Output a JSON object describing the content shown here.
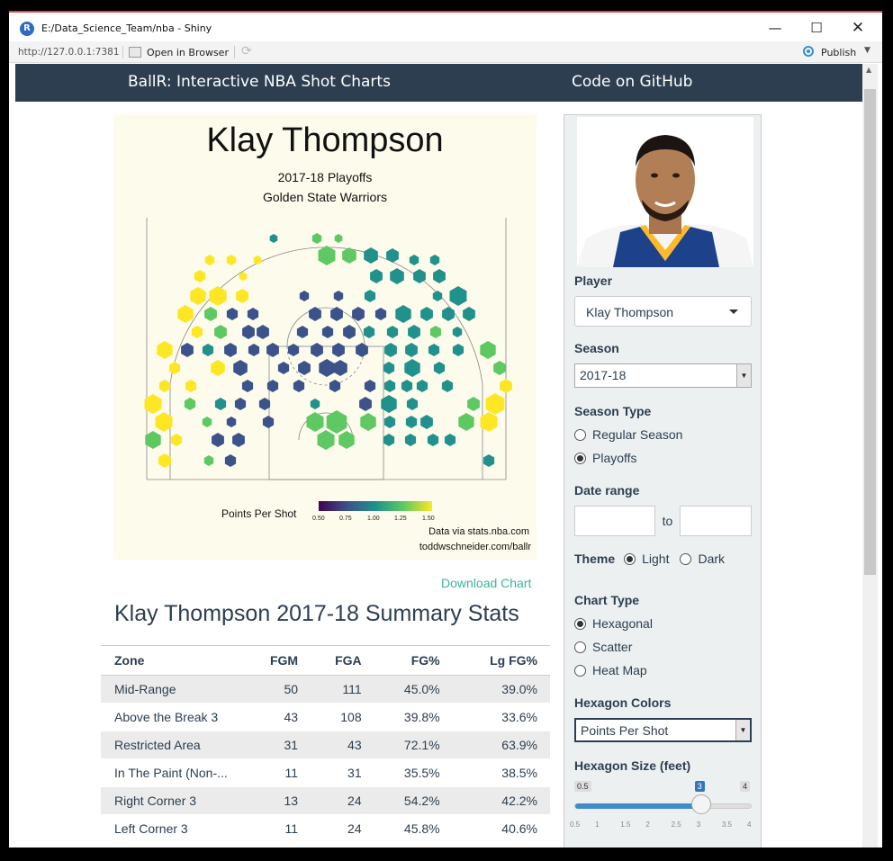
{
  "window": {
    "title": "E:/Data_Science_Team/nba - Shiny",
    "address": "http://127.0.0.1:7381",
    "open_in_browser": "Open in Browser",
    "publish": "Publish"
  },
  "navbar": {
    "brand": "BallR: Interactive NBA Shot Charts",
    "link": "Code on GitHub"
  },
  "chart": {
    "title": "Klay Thompson",
    "subtitle1": "2017-18 Playoffs",
    "subtitle2": "Golden State Warriors",
    "legend_label": "Points Per Shot",
    "legend_ticks": [
      "0.50",
      "0.75",
      "1.00",
      "1.25",
      "1.50"
    ],
    "credit1": "Data via stats.nba.com",
    "credit2": "toddwschneider.com/ballr",
    "colors": [
      "#440154",
      "#3b528b",
      "#21918c",
      "#5ec962",
      "#fde725"
    ]
  },
  "download_label": "Download Chart",
  "stats": {
    "heading": "Klay Thompson 2017-18 Summary Stats",
    "columns": [
      "Zone",
      "FGM",
      "FGA",
      "FG%",
      "Lg FG%"
    ],
    "rows": [
      [
        "Mid-Range",
        "50",
        "111",
        "45.0%",
        "39.0%"
      ],
      [
        "Above the Break 3",
        "43",
        "108",
        "39.8%",
        "33.6%"
      ],
      [
        "Restricted Area",
        "31",
        "43",
        "72.1%",
        "63.9%"
      ],
      [
        "In The Paint (Non-...",
        "11",
        "31",
        "35.5%",
        "38.5%"
      ],
      [
        "Right Corner 3",
        "13",
        "24",
        "54.2%",
        "42.2%"
      ],
      [
        "Left Corner 3",
        "11",
        "24",
        "45.8%",
        "40.6%"
      ]
    ]
  },
  "sidebar": {
    "player_label": "Player",
    "player_value": "Klay Thompson",
    "season_label": "Season",
    "season_value": "2017-18",
    "season_type_label": "Season Type",
    "season_type_options": [
      "Regular Season",
      "Playoffs"
    ],
    "season_type_selected": "Playoffs",
    "date_range_label": "Date range",
    "date_to": "to",
    "theme_label": "Theme",
    "theme_options": [
      "Light",
      "Dark"
    ],
    "theme_selected": "Light",
    "chart_type_label": "Chart Type",
    "chart_type_options": [
      "Hexagonal",
      "Scatter",
      "Heat Map"
    ],
    "chart_type_selected": "Hexagonal",
    "hex_colors_label": "Hexagon Colors",
    "hex_colors_value": "Points Per Shot",
    "hex_size_label": "Hexagon Size (feet)",
    "hex_size": {
      "min": "0.5",
      "max": "4",
      "value": "3",
      "value_num": 3,
      "min_num": 0.5,
      "max_num": 4
    },
    "hex_size_ticks": [
      "0.5",
      "1",
      "1.5",
      "2",
      "2.5",
      "3",
      "3.5",
      "4"
    ]
  }
}
